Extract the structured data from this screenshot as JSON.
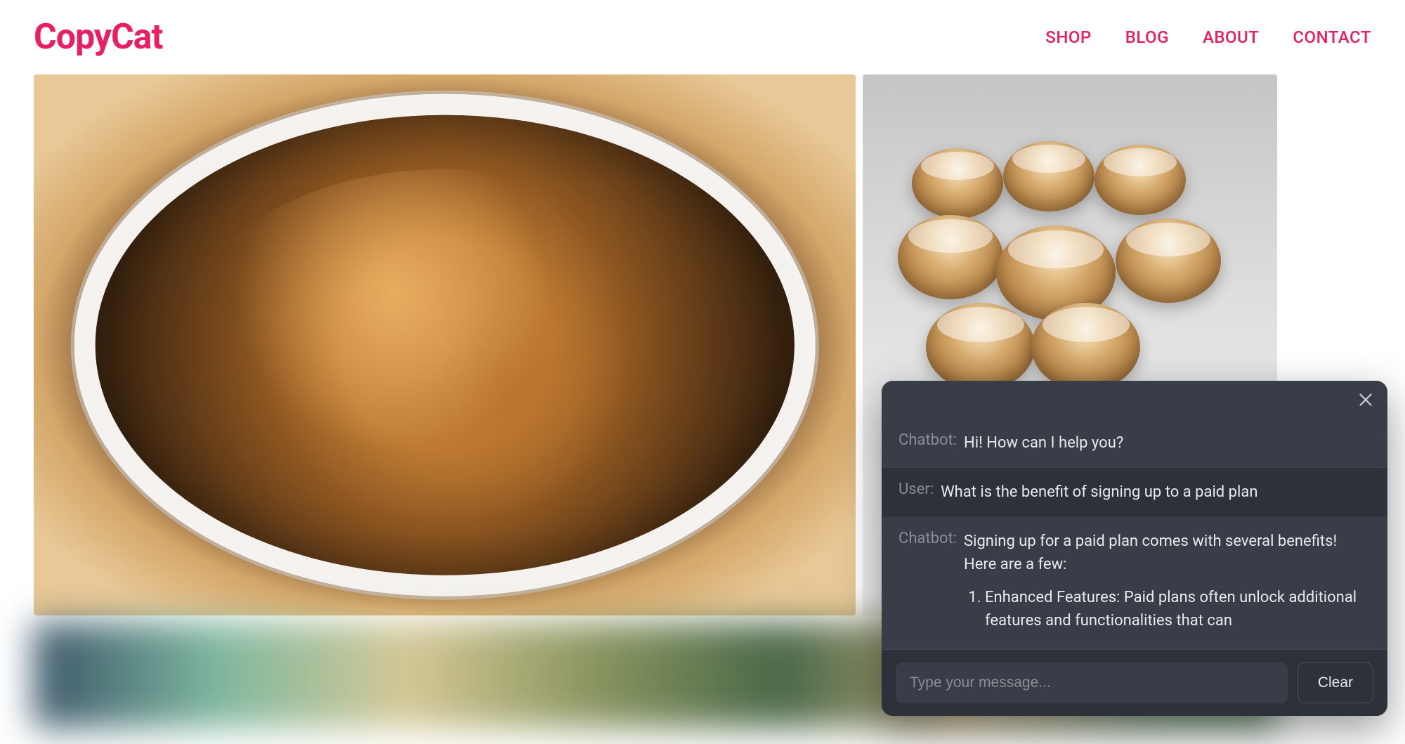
{
  "header": {
    "logo": "CopyCat",
    "nav": [
      {
        "label": "SHOP"
      },
      {
        "label": "BLOG"
      },
      {
        "label": "ABOUT"
      },
      {
        "label": "CONTACT"
      }
    ]
  },
  "chatbot": {
    "messages": [
      {
        "sender": "Chatbot:",
        "text": "Hi! How can I help you?"
      },
      {
        "sender": "User:",
        "text": "What is the benefit of signing up to a paid plan"
      },
      {
        "sender": "Chatbot:",
        "text": "Signing up for a paid plan comes with several benefits! Here are a few:",
        "list_item_1": "Enhanced Features: Paid plans often unlock additional features and functionalities that can"
      }
    ],
    "input_placeholder": "Type your message...",
    "clear_label": "Clear"
  }
}
